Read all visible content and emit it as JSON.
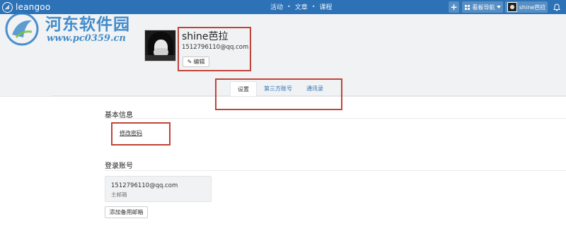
{
  "topbar": {
    "brand": "leangoo",
    "nav": [
      "活动",
      "文章",
      "课程"
    ],
    "separator": "•",
    "plus_label": "+",
    "board_nav_label": "看板导航",
    "user_label": "shine芭拉",
    "bell_icon": "bell-icon",
    "bg_color": "#2d72b6"
  },
  "watermark": {
    "title": "河东软件园",
    "url": "www.pc0359.cn"
  },
  "profile": {
    "name": "shine芭拉",
    "email": "1512796110@qq.com",
    "edit_label": "编辑"
  },
  "tabs": [
    {
      "label": "设置",
      "active": true
    },
    {
      "label": "第三方账号",
      "active": false
    },
    {
      "label": "通讯录",
      "active": false
    }
  ],
  "basic_info": {
    "title": "基本信息",
    "change_password": "修改密码"
  },
  "login_account": {
    "title": "登录账号",
    "email": "1512796110@qq.com",
    "email_tag": "主邮箱",
    "add_button": "添加备用邮箱"
  },
  "colors": {
    "highlight": "#c0443a",
    "link": "#2d72b6"
  }
}
